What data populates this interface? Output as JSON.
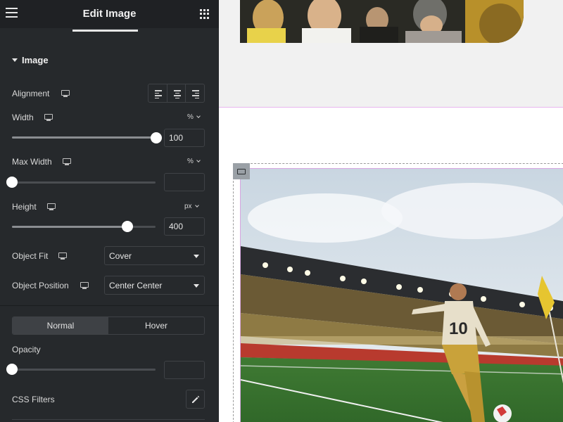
{
  "header": {
    "title": "Edit Image",
    "menu_icon": "hamburger-menu-icon",
    "apps_icon": "grid-apps-icon"
  },
  "section": {
    "title": "Image"
  },
  "controls": {
    "alignment": {
      "label": "Alignment"
    },
    "width": {
      "label": "Width",
      "unit": "%",
      "value": "100",
      "slider_fraction": 1.0
    },
    "max_width": {
      "label": "Max Width",
      "unit": "%",
      "value": "",
      "slider_fraction": 0.0
    },
    "height": {
      "label": "Height",
      "unit": "px",
      "value": "400",
      "slider_fraction": 0.8
    },
    "object_fit": {
      "label": "Object Fit",
      "selected": "Cover"
    },
    "object_position": {
      "label": "Object Position",
      "selected": "Center Center"
    },
    "state_tabs": [
      {
        "label": "Normal",
        "active": true
      },
      {
        "label": "Hover",
        "active": false
      }
    ],
    "opacity": {
      "label": "Opacity",
      "value": "",
      "slider_fraction": 0.0
    },
    "css_filters": {
      "label": "CSS Filters"
    }
  },
  "colors": {
    "panel_bg": "#26292c",
    "header_bg": "#1f2124",
    "canvas_bg": "#f1f1f1",
    "selection_outline": "#d7a6e0"
  }
}
